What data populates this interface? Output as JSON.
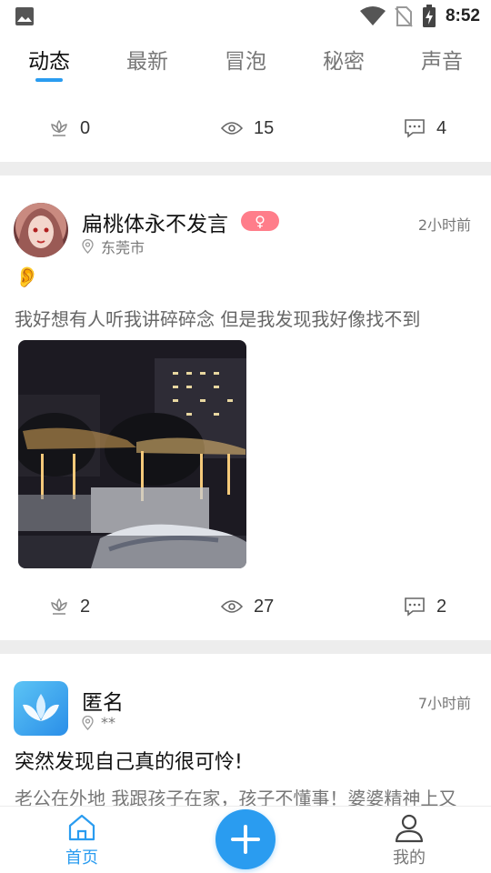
{
  "status_bar": {
    "time": "8:52",
    "icons": [
      "image-icon",
      "wifi-icon",
      "no-sim-icon",
      "battery-charging-icon"
    ]
  },
  "tabs": [
    {
      "label": "动态",
      "active": true
    },
    {
      "label": "最新",
      "active": false
    },
    {
      "label": "冒泡",
      "active": false
    },
    {
      "label": "秘密",
      "active": false
    },
    {
      "label": "声音",
      "active": false
    }
  ],
  "previous_post_stats": {
    "likes": "0",
    "views": "15",
    "comments": "4"
  },
  "posts": [
    {
      "username": "扁桃体永不发言",
      "gender": "♀",
      "location": "东莞市",
      "time": "2小时前",
      "emoji": "👂",
      "text": "我好想有人听我讲碎碎念  但是我发现我好像找不到",
      "stats": {
        "likes": "2",
        "views": "27",
        "comments": "2"
      }
    },
    {
      "username": "匿名",
      "location": "**",
      "time": "7小时前",
      "title": "突然发现自己真的很可怜!",
      "text": "老公在外地 我跟孩子在家，孩子不懂事！婆婆精神上又"
    }
  ],
  "bottom_nav": {
    "home_label": "首页",
    "mine_label": "我的"
  },
  "colors": {
    "accent": "#2a9cf0",
    "female_badge": "#ff7d8a",
    "divider": "#ededed"
  }
}
